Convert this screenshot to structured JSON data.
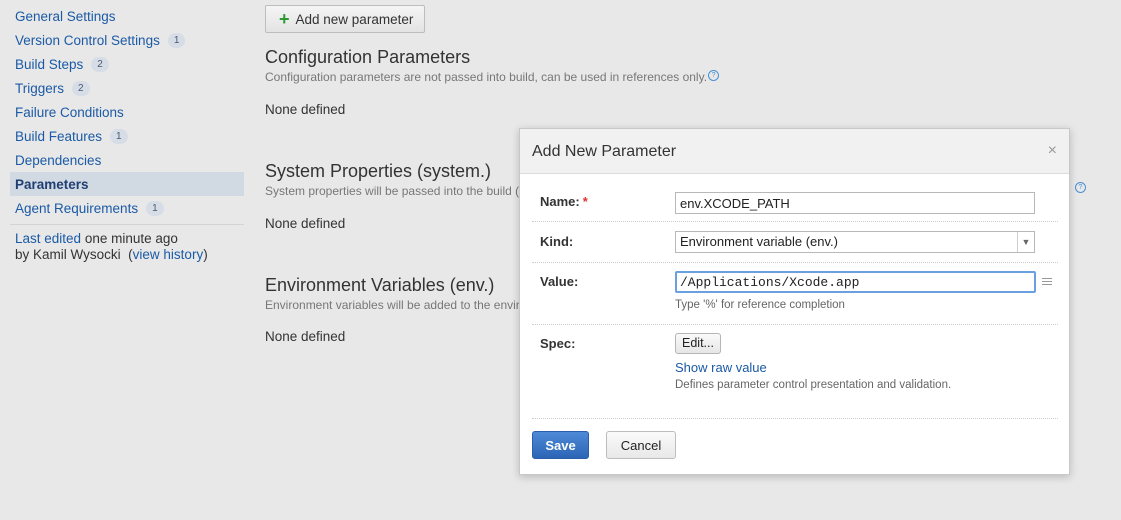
{
  "sidebar": {
    "items": [
      {
        "label": "General Settings",
        "badge": null
      },
      {
        "label": "Version Control Settings",
        "badge": "1"
      },
      {
        "label": "Build Steps",
        "badge": "2"
      },
      {
        "label": "Triggers",
        "badge": "2"
      },
      {
        "label": "Failure Conditions",
        "badge": null
      },
      {
        "label": "Build Features",
        "badge": "1"
      },
      {
        "label": "Dependencies",
        "badge": null
      },
      {
        "label": "Parameters",
        "badge": null,
        "active": true
      },
      {
        "label": "Agent Requirements",
        "badge": "1"
      }
    ],
    "last_edited_link": "Last edited",
    "last_edited_time": "one minute ago",
    "by_text": "by Kamil Wysocki",
    "view_history_open": "(",
    "view_history": "view history",
    "view_history_close": ")"
  },
  "main": {
    "add_button": "Add new parameter",
    "sections": [
      {
        "title": "Configuration Parameters",
        "desc": "Configuration parameters are not passed into build, can be used in references only.",
        "empty": "None defined"
      },
      {
        "title": "System Properties (system.)",
        "desc": "System properties will be passed into the build (",
        "empty": "None defined"
      },
      {
        "title": "Environment Variables (env.)",
        "desc": "Environment variables will be added to the envir",
        "empty": "None defined"
      }
    ],
    "help_glyph": "?"
  },
  "dialog": {
    "title": "Add New Parameter",
    "close": "×",
    "name_label": "Name:",
    "required_mark": "*",
    "name_value": "env.XCODE_PATH",
    "kind_label": "Kind:",
    "kind_value": "Environment variable (env.)",
    "value_label": "Value:",
    "value_value": "/Applications/Xcode.app",
    "value_hint": "Type '%' for reference completion",
    "spec_label": "Spec:",
    "edit_button": "Edit...",
    "show_raw_value": "Show raw value",
    "spec_hint": "Defines parameter control presentation and validation.",
    "save": "Save",
    "cancel": "Cancel"
  },
  "colors": {
    "accent": "#2c65b6",
    "link": "#1b5aa6",
    "add_icon": "#2a9a35"
  }
}
